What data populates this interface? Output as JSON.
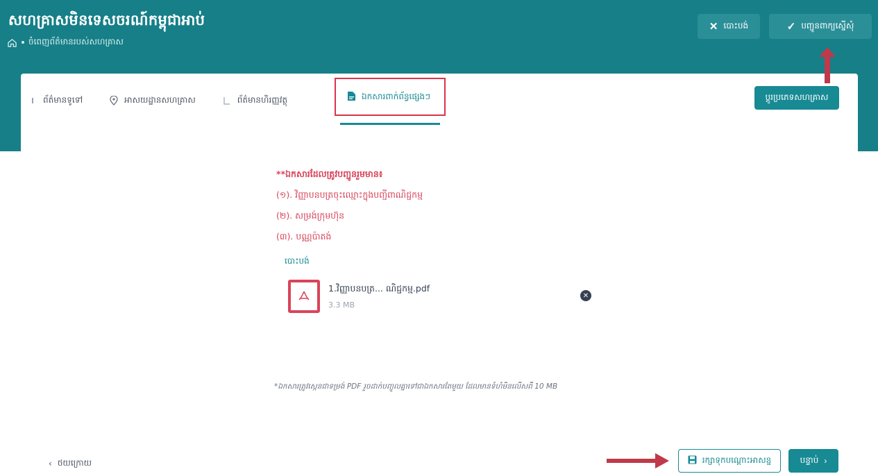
{
  "app": {
    "title": "សហគ្រាសមិនទេសចរណ៍កម្ពុជាអាប់",
    "breadcrumb": "ចំពេញព័ត៌មានរបស់សហគ្រាស"
  },
  "header_actions": {
    "cancel_label": "បោះបង់",
    "submit_label": "បញ្ជូនពាក្យស្នើសុំ"
  },
  "tabs": [
    {
      "label": "ព័ត៌មានទូទៅ",
      "icon": "info-icon"
    },
    {
      "label": "អាសយដ្ឋានសហគ្រាស",
      "icon": "location-pin-icon"
    },
    {
      "label": "ព័ត៌មានហិរញ្ញវត្ថុ",
      "icon": "bracket-icon"
    },
    {
      "label": "ឯកសារពាក់ព័ន្ធផ្សេងៗ",
      "icon": "document-icon",
      "active": true
    }
  ],
  "change_button_label": "ប្តូរប្រភេទសហគ្រាស",
  "requirements": {
    "heading": "**ឯកសារដែលត្រូវបញ្ជូនរួមមាន៖",
    "items": [
      "(១). វិញ្ញាបនបត្រចុះឈ្មោះក្នុងបញ្ជីពាណិជ្ជកម្ម",
      "(២). សម្រង់ក្រុមហ៊ុន",
      "(៣). បណ្ណប៉ាតង់"
    ]
  },
  "remove_link": "បោះបង់",
  "file": {
    "name": "1.វិញ្ញាបនបត្រ... ណិជ្ជកម្ម.pdf",
    "size": "3.3 MB"
  },
  "note": "*ឯកសារត្រូវស្កេនជាទម្រង់ PDF រួចដាក់បញ្ចូលគ្នាទៅជាឯកសារតែមួយ ដែលមានទំហំមិនលើសពី 10 MB",
  "footer": {
    "back_label": "ថយក្រោយ",
    "save_label": "រក្សាទុកបណ្ដោះអាសន្ន",
    "next_label": "បន្ទាប់"
  },
  "colors": {
    "teal": "#167f88",
    "accent_red": "#d9344a"
  }
}
